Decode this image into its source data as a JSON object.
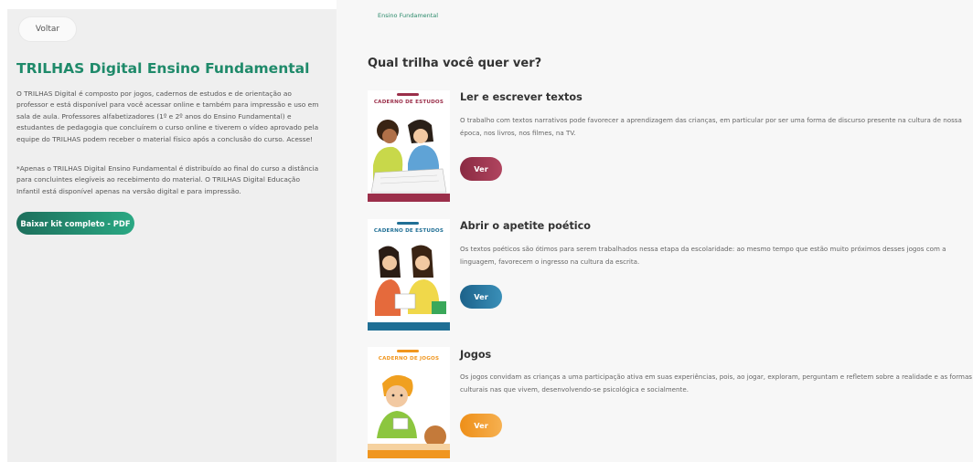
{
  "left": {
    "back_label": "Voltar",
    "title": "TRILHAS Digital Ensino Fundamental",
    "paragraph1": "O TRILHAS Digital é composto por jogos, cadernos de estudos e de orientação ao professor e está disponível para você acessar online e também para impressão e uso em sala de aula. Professores alfabetizadores (1º e 2º anos do Ensino Fundamental) e estudantes de pedagogia que concluírem o curso online e tiverem o vídeo aprovado pela equipe do TRILHAS podem receber o material físico após a conclusão do curso. Acesse!",
    "paragraph2": "*Apenas o TRILHAS Digital Ensino Fundamental é distribuído ao final do curso a distância para concluintes elegíveis ao recebimento do material. O TRILHAS Digital Educação Infantil está disponível apenas na versão digital e para impressão.",
    "download_label": "Baixar kit completo - PDF"
  },
  "right": {
    "breadcrumb": "Ensino Fundamental",
    "heading": "Qual trilha você quer ver?",
    "trails": [
      {
        "cover_title": "CADERNO DE ESTUDOS",
        "title": "Ler e escrever textos",
        "description": "O trabalho com textos narrativos pode favorecer a aprendizagem das crianças, em particular por ser uma forma de discurso presente na cultura de nossa época, nos livros, nos filmes, na TV.",
        "button_label": "Ver",
        "color": "#9b2f4a"
      },
      {
        "cover_title": "CADERNO DE ESTUDOS",
        "title": "Abrir o apetite poético",
        "description": "Os textos poéticos são ótimos para serem trabalhados nessa etapa da escolaridade: ao mesmo tempo que estão muito próximos desses jogos com a linguagem, favorecem o ingresso na cultura da escrita.",
        "button_label": "Ver",
        "color": "#1f6f95"
      },
      {
        "cover_title": "CADERNO DE JOGOS",
        "title": "Jogos",
        "description": "Os jogos convidam as crianças a uma participação ativa em suas experiências, pois, ao jogar, exploram, perguntam e refletem sobre a realidade e as formas culturais nas que vivem, desenvolvendo-se psicológica e socialmente.",
        "button_label": "Ver",
        "color": "#f0961f"
      }
    ]
  }
}
